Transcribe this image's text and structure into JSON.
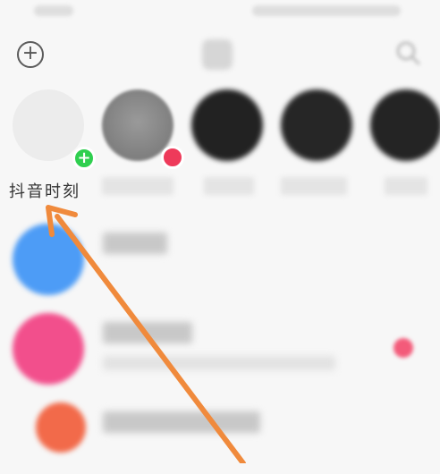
{
  "status_bar": {},
  "top_bar": {
    "add_icon": "plus-circle-icon",
    "add_glyph": "+",
    "center_icon": "contacts-icon",
    "search_icon": "search-icon"
  },
  "stories": [
    {
      "label": "抖音时刻",
      "badge": "add",
      "badge_glyph": "+",
      "color": "#ececec"
    },
    {
      "label": "",
      "badge": "live",
      "color": "#8a8a8a"
    },
    {
      "label": "",
      "color": "#222222"
    },
    {
      "label": "",
      "color": "#262626"
    },
    {
      "label": "",
      "color": "#242424"
    }
  ],
  "conversations": [
    {
      "avatar_color": "#4d9cf6",
      "has_dot": false
    },
    {
      "avatar_color": "#f24f8c",
      "has_dot": true
    },
    {
      "avatar_color": "#f26a4a",
      "has_dot": false
    }
  ],
  "colors": {
    "accent_green": "#2fcf4f",
    "accent_red": "#ee3a5a",
    "arrow": "#f08a3c"
  }
}
